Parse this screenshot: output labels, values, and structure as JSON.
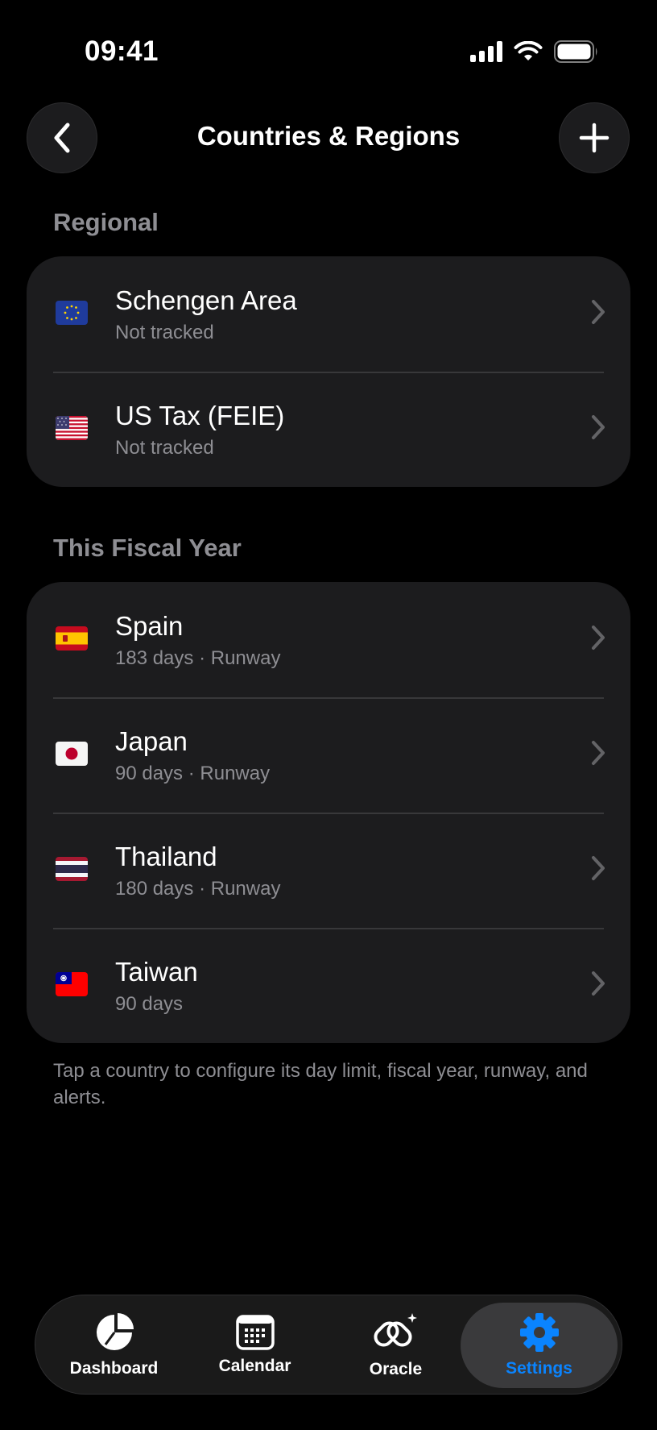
{
  "status_bar": {
    "time": "09:41"
  },
  "nav": {
    "title": "Countries & Regions"
  },
  "sections": [
    {
      "header": "Regional",
      "items": [
        {
          "name": "Schengen Area",
          "subtitle": "Not tracked",
          "flag": "eu-flag"
        },
        {
          "name": "US Tax (FEIE)",
          "subtitle": "Not tracked",
          "flag": "us-flag"
        }
      ]
    },
    {
      "header": "This Fiscal Year",
      "items": [
        {
          "name": "Spain",
          "subtitle": "183 days · Runway",
          "flag": "spain-flag"
        },
        {
          "name": "Japan",
          "subtitle": "90 days · Runway",
          "flag": "japan-flag"
        },
        {
          "name": "Thailand",
          "subtitle": "180 days · Runway",
          "flag": "thailand-flag"
        },
        {
          "name": "Taiwan",
          "subtitle": "90 days",
          "flag": "taiwan-flag"
        }
      ]
    }
  ],
  "footer_note": "Tap a country to configure its day limit, fiscal year, runway, and alerts.",
  "tab_bar": {
    "tabs": [
      {
        "label": "Dashboard",
        "icon": "pie-chart-icon"
      },
      {
        "label": "Calendar",
        "icon": "calendar-icon"
      },
      {
        "label": "Oracle",
        "icon": "oracle-sparkle-icon"
      },
      {
        "label": "Settings",
        "icon": "gear-icon"
      }
    ],
    "active": "Settings"
  },
  "colors": {
    "accent": "#0a84ff",
    "background": "#000000",
    "card": "#1c1c1e",
    "secondary_text": "#8e8e93"
  }
}
